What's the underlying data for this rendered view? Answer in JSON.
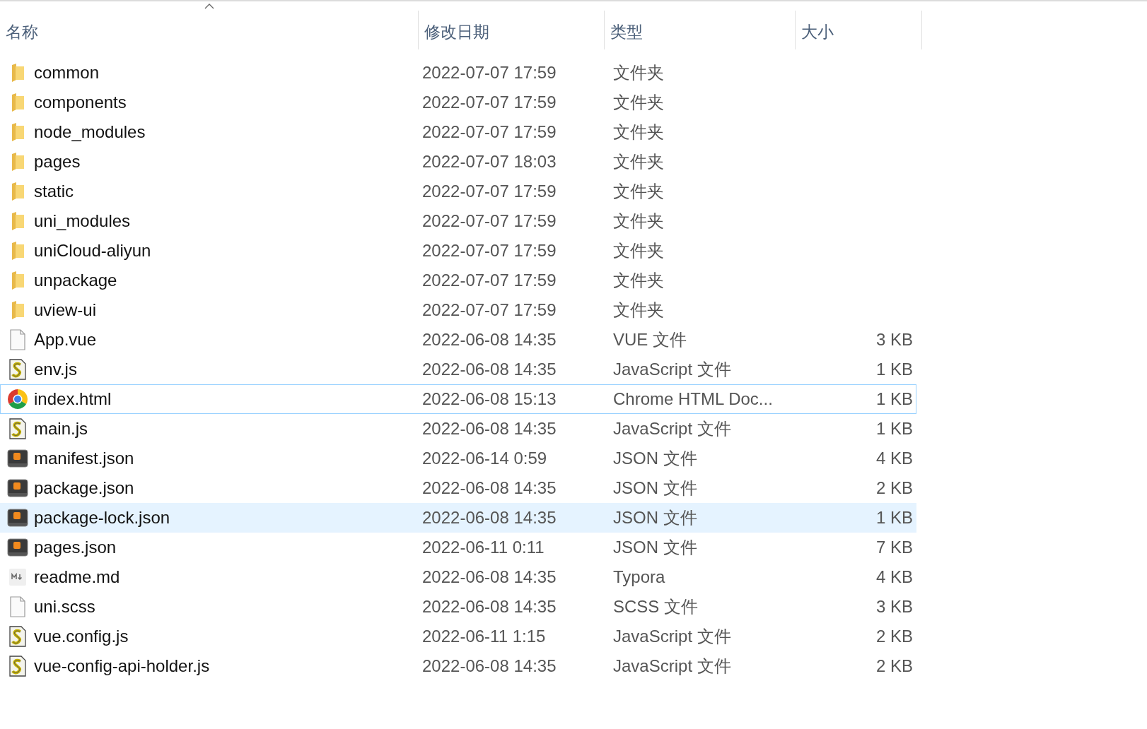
{
  "columns": [
    {
      "label": "名称",
      "sorted": true
    },
    {
      "label": "修改日期",
      "sorted": false
    },
    {
      "label": "类型",
      "sorted": false
    },
    {
      "label": "大小",
      "sorted": false
    }
  ],
  "rows": [
    {
      "kind": "folder",
      "name": "common",
      "date": "2022-07-07 17:59",
      "type": "文件夹",
      "selected": false,
      "focused": false
    },
    {
      "kind": "folder",
      "name": "components",
      "date": "2022-07-07 17:59",
      "type": "文件夹",
      "selected": false,
      "focused": false
    },
    {
      "kind": "folder",
      "name": "node_modules",
      "date": "2022-07-07 17:59",
      "type": "文件夹",
      "selected": false,
      "focused": false
    },
    {
      "kind": "folder",
      "name": "pages",
      "date": "2022-07-07 18:03",
      "type": "文件夹",
      "selected": false,
      "focused": false
    },
    {
      "kind": "folder",
      "name": "static",
      "date": "2022-07-07 17:59",
      "type": "文件夹",
      "selected": false,
      "focused": false
    },
    {
      "kind": "folder",
      "name": "uni_modules",
      "date": "2022-07-07 17:59",
      "type": "文件夹",
      "selected": false,
      "focused": false
    },
    {
      "kind": "folder",
      "name": "uniCloud-aliyun",
      "date": "2022-07-07 17:59",
      "type": "文件夹",
      "selected": false,
      "focused": false
    },
    {
      "kind": "folder",
      "name": "unpackage",
      "date": "2022-07-07 17:59",
      "type": "文件夹",
      "selected": false,
      "focused": false
    },
    {
      "kind": "folder",
      "name": "uview-ui",
      "date": "2022-07-07 17:59",
      "type": "文件夹",
      "selected": false,
      "focused": false
    },
    {
      "kind": "file",
      "name": "App.vue",
      "date": "2022-06-08 14:35",
      "type": "VUE 文件",
      "size": "3 KB",
      "selected": false,
      "focused": false
    },
    {
      "kind": "script",
      "name": "env.js",
      "date": "2022-06-08 14:35",
      "type": "JavaScript 文件",
      "size": "1 KB",
      "selected": false,
      "focused": false
    },
    {
      "kind": "browser",
      "name": "index.html",
      "date": "2022-06-08 15:13",
      "type": "Chrome HTML Doc...",
      "size": "1 KB",
      "selected": false,
      "focused": true
    },
    {
      "kind": "script",
      "name": "main.js",
      "date": "2022-06-08 14:35",
      "type": "JavaScript 文件",
      "size": "1 KB",
      "selected": false,
      "focused": false
    },
    {
      "kind": "editor",
      "name": "manifest.json",
      "date": "2022-06-14 0:59",
      "type": "JSON 文件",
      "size": "4 KB",
      "selected": false,
      "focused": false
    },
    {
      "kind": "editor",
      "name": "package.json",
      "date": "2022-06-08 14:35",
      "type": "JSON 文件",
      "size": "2 KB",
      "selected": false,
      "focused": false
    },
    {
      "kind": "editor",
      "name": "package-lock.json",
      "date": "2022-06-08 14:35",
      "type": "JSON 文件",
      "size": "1 KB",
      "selected": true,
      "focused": false
    },
    {
      "kind": "editor",
      "name": "pages.json",
      "date": "2022-06-11 0:11",
      "type": "JSON 文件",
      "size": "7 KB",
      "selected": false,
      "focused": false
    },
    {
      "kind": "markdown",
      "name": "readme.md",
      "date": "2022-06-08 14:35",
      "type": "Typora",
      "size": "4 KB",
      "selected": false,
      "focused": false
    },
    {
      "kind": "file",
      "name": "uni.scss",
      "date": "2022-06-08 14:35",
      "type": "SCSS 文件",
      "size": "3 KB",
      "selected": false,
      "focused": false
    },
    {
      "kind": "script",
      "name": "vue.config.js",
      "date": "2022-06-11 1:15",
      "type": "JavaScript 文件",
      "size": "2 KB",
      "selected": false,
      "focused": false
    },
    {
      "kind": "script",
      "name": "vue-config-api-holder.js",
      "date": "2022-06-08 14:35",
      "type": "JavaScript 文件",
      "size": "2 KB",
      "selected": false,
      "focused": false
    }
  ]
}
